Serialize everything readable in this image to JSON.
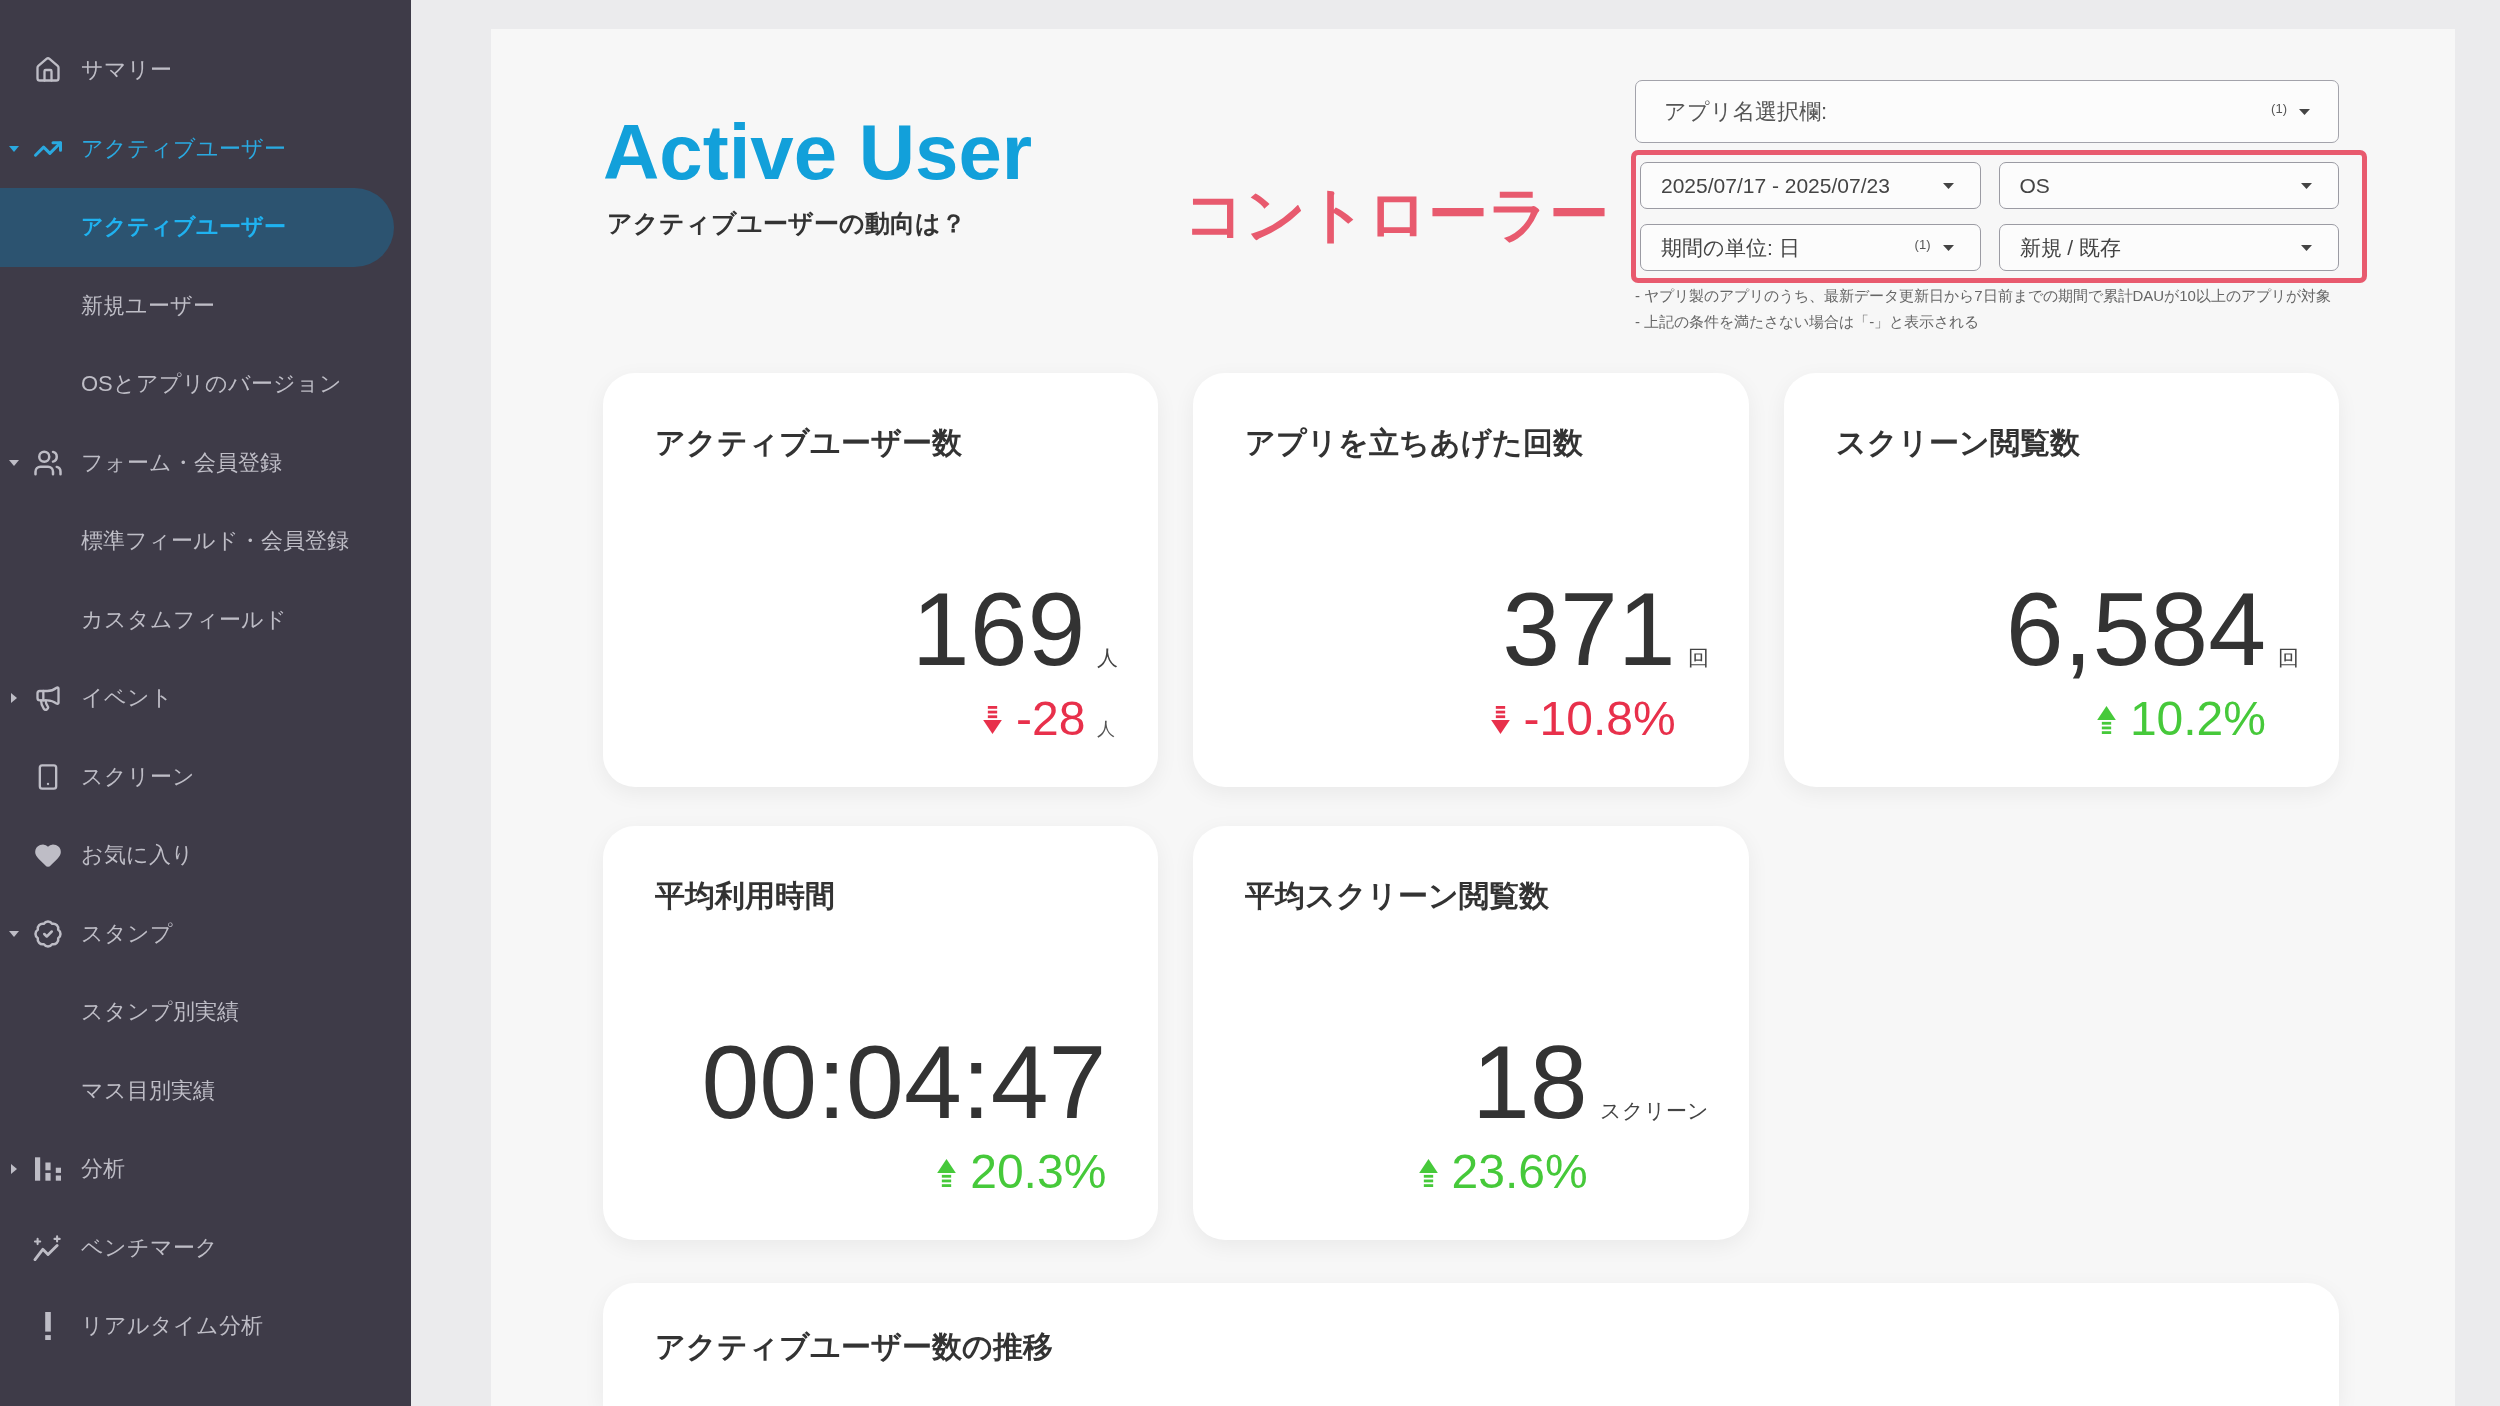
{
  "sidebar": {
    "items": [
      {
        "kind": "link",
        "label": "サマリー",
        "selected": false
      },
      {
        "kind": "group",
        "label": "アクティブユーザー",
        "selected": true,
        "expanded": true,
        "children": [
          {
            "label": "アクティブユーザー",
            "selected": true
          },
          {
            "label": "新規ユーザー",
            "selected": false
          },
          {
            "label": "OSとアプリのバージョン",
            "selected": false
          }
        ]
      },
      {
        "kind": "group",
        "label": "フォーム・会員登録",
        "selected": false,
        "expanded": true,
        "children": [
          {
            "label": "標準フィールド・会員登録",
            "selected": false
          },
          {
            "label": "カスタムフィールド",
            "selected": false
          }
        ]
      },
      {
        "kind": "group",
        "label": "イベント",
        "selected": false,
        "expanded": false
      },
      {
        "kind": "link",
        "label": "スクリーン",
        "selected": false
      },
      {
        "kind": "link",
        "label": "お気に入り",
        "selected": false
      },
      {
        "kind": "group",
        "label": "スタンプ",
        "selected": false,
        "expanded": true,
        "children": [
          {
            "label": "スタンプ別実績",
            "selected": false
          },
          {
            "label": "マス目別実績",
            "selected": false
          }
        ]
      },
      {
        "kind": "group",
        "label": "分析",
        "selected": false,
        "expanded": false
      },
      {
        "kind": "link",
        "label": "ベンチマーク",
        "selected": false
      },
      {
        "kind": "link",
        "label": "リアルタイム分析",
        "selected": false
      }
    ]
  },
  "header": {
    "title": "Active User",
    "subtitle": "アクティブユーザーの動向は？"
  },
  "annotation": {
    "label": "コントローラー"
  },
  "controls": {
    "app_select": {
      "label": "アプリ名選択欄:",
      "count": "(1)"
    },
    "filters": [
      {
        "value": "2025/07/17 - 2025/07/23"
      },
      {
        "value": "OS"
      },
      {
        "value": "期間の単位: 日",
        "count": "(1)"
      },
      {
        "value": "新規 / 既存"
      }
    ],
    "notes": [
      "- ヤプリ製のアプリのうち、最新データ更新日から7日前までの期間で累計DAUが10以上のアプリが対象",
      "- 上記の条件を満たさない場合は「-」と表示される"
    ]
  },
  "cards": [
    {
      "title": "アクティブユーザー数",
      "value": "169",
      "unit": "人",
      "change": "-28",
      "change_unit": "人",
      "increase": false
    },
    {
      "title": "アプリを立ちあげた回数",
      "value": "371",
      "unit": "回",
      "change": "-10.8%",
      "increase": false
    },
    {
      "title": "スクリーン閲覧数",
      "value": "6,584",
      "unit": "回",
      "change": "10.2%",
      "increase": true
    },
    {
      "title": "平均利用時間",
      "value": "00:04:47",
      "change": "20.3%",
      "increase": true
    },
    {
      "title": "平均スクリーン閲覧数",
      "value": "18",
      "unit": "スクリーン",
      "change": "23.6%",
      "increase": true
    }
  ],
  "trend_card": {
    "title": "アクティブユーザー数の推移"
  }
}
